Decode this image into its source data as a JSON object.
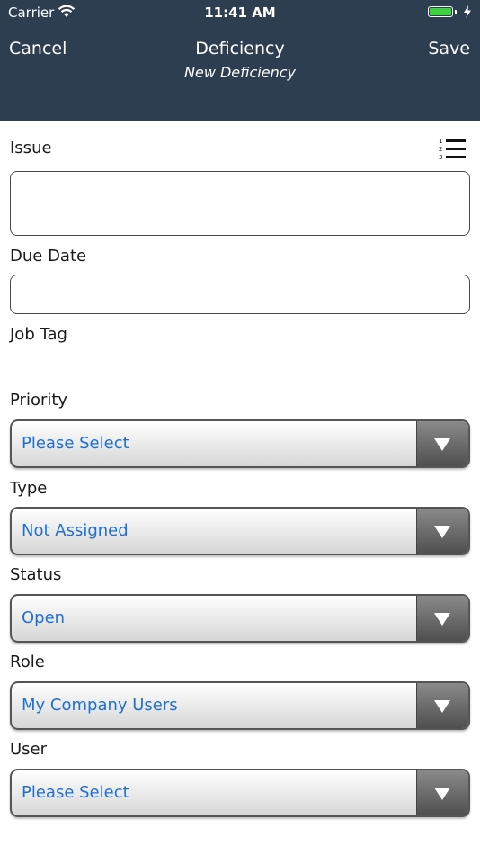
{
  "status_bar": {
    "carrier": "Carrier",
    "time": "11:41 AM"
  },
  "nav": {
    "cancel_label": "Cancel",
    "title": "Deficiency",
    "subtitle": "New Deficiency",
    "save_label": "Save"
  },
  "form": {
    "issue_label": "Issue",
    "issue_value": "",
    "due_date_label": "Due Date",
    "due_date_value": "",
    "job_tag_label": "Job Tag",
    "priority": {
      "label": "Priority",
      "value": "Please Select"
    },
    "type": {
      "label": "Type",
      "value": "Not Assigned"
    },
    "status": {
      "label": "Status",
      "value": "Open"
    },
    "role": {
      "label": "Role",
      "value": "My Company Users"
    },
    "user": {
      "label": "User",
      "value": "Please Select"
    }
  },
  "colors": {
    "header_bg": "#2c3e50",
    "select_text": "#1f6fd1",
    "battery": "#3cd33c"
  },
  "icons": [
    "wifi-icon",
    "battery-icon",
    "charging-bolt-icon",
    "numbered-list-icon",
    "dropdown-arrow-icon"
  ]
}
